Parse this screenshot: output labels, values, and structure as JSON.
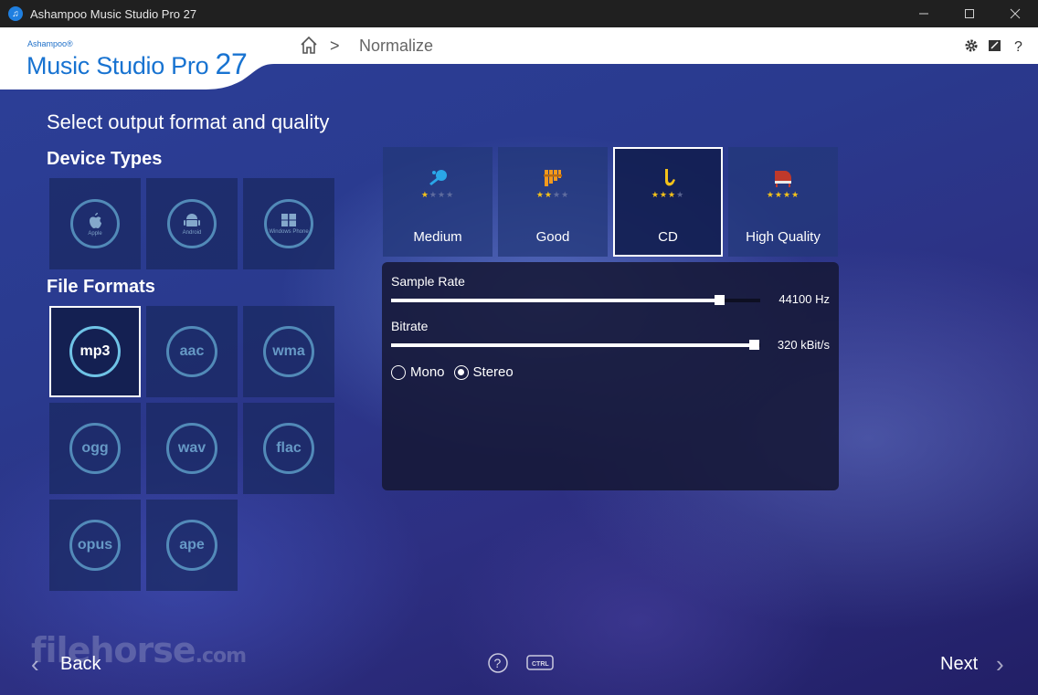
{
  "window": {
    "title": "Ashampoo Music Studio Pro 27",
    "controls": [
      "minimize",
      "maximize",
      "close"
    ]
  },
  "brand": {
    "small": "Ashampoo®",
    "name": "Music Studio Pro",
    "version": "27"
  },
  "breadcrumb": {
    "current": "Normalize",
    "separator": ">"
  },
  "header_icons": [
    "gear-icon",
    "edit-icon",
    "help-icon"
  ],
  "page": {
    "title": "Select output format and quality",
    "device_types_title": "Device Types",
    "file_formats_title": "File Formats"
  },
  "device_types": [
    {
      "id": "apple",
      "label": "Apple"
    },
    {
      "id": "android",
      "label": "Android"
    },
    {
      "id": "windows",
      "label": "Windows Phone"
    }
  ],
  "file_formats": [
    "mp3",
    "aac",
    "wma",
    "ogg",
    "wav",
    "flac",
    "opus",
    "ape"
  ],
  "selected_format": "mp3",
  "quality_presets": [
    {
      "label": "Medium",
      "stars": 1,
      "icon": "trumpet-icon",
      "color": "#2aa7e8"
    },
    {
      "label": "Good",
      "stars": 2,
      "icon": "pan-flute-icon",
      "color": "#f39a1e"
    },
    {
      "label": "CD",
      "stars": 3,
      "icon": "saxophone-icon",
      "color": "#f4c21a"
    },
    {
      "label": "High Quality",
      "stars": 4,
      "icon": "piano-icon",
      "color": "#c0392b"
    }
  ],
  "selected_quality": "CD",
  "settings": {
    "sample_rate_label": "Sample Rate",
    "sample_rate_value": "44100 Hz",
    "sample_rate_level": 0.89,
    "bitrate_label": "Bitrate",
    "bitrate_value": "320 kBit/s",
    "bitrate_level": 0.985,
    "channel_options": [
      "Mono",
      "Stereo"
    ],
    "selected_channel": "Stereo"
  },
  "footer": {
    "back_label": "Back",
    "next_label": "Next",
    "help_icon": "help-circle-icon",
    "ctrl_icon": "CTRL"
  },
  "watermark": {
    "text": "filehorse",
    "suffix": ".com"
  }
}
